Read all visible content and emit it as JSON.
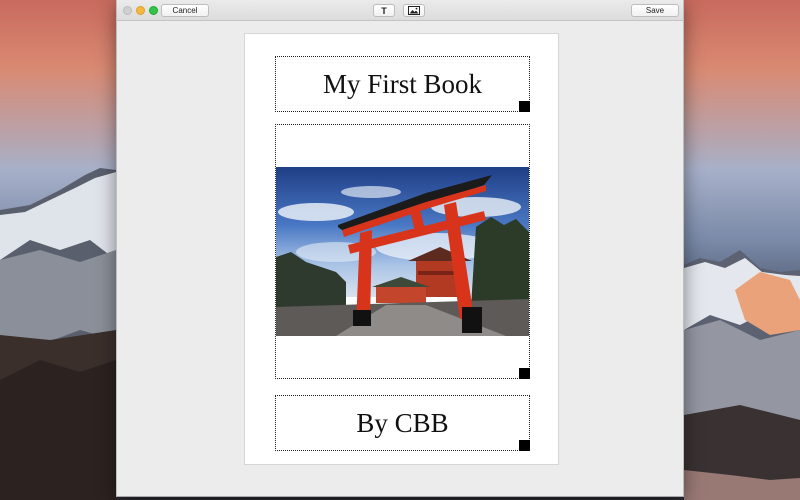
{
  "window": {
    "toolbar": {
      "cancel_label": "Cancel",
      "save_label": "Save",
      "text_tool_label": "T"
    },
    "icons": {
      "text_tool": "text-icon",
      "image_tool": "image-icon"
    }
  },
  "book": {
    "title": "My First Book",
    "author": "By CBB",
    "image_description": "Red torii gate in front of a shrine under a blue sky"
  },
  "colors": {
    "traffic_close": "#cfcfcf",
    "traffic_minimize": "#f5b83c",
    "traffic_zoom": "#33c448",
    "torii_red": "#d8341c"
  }
}
